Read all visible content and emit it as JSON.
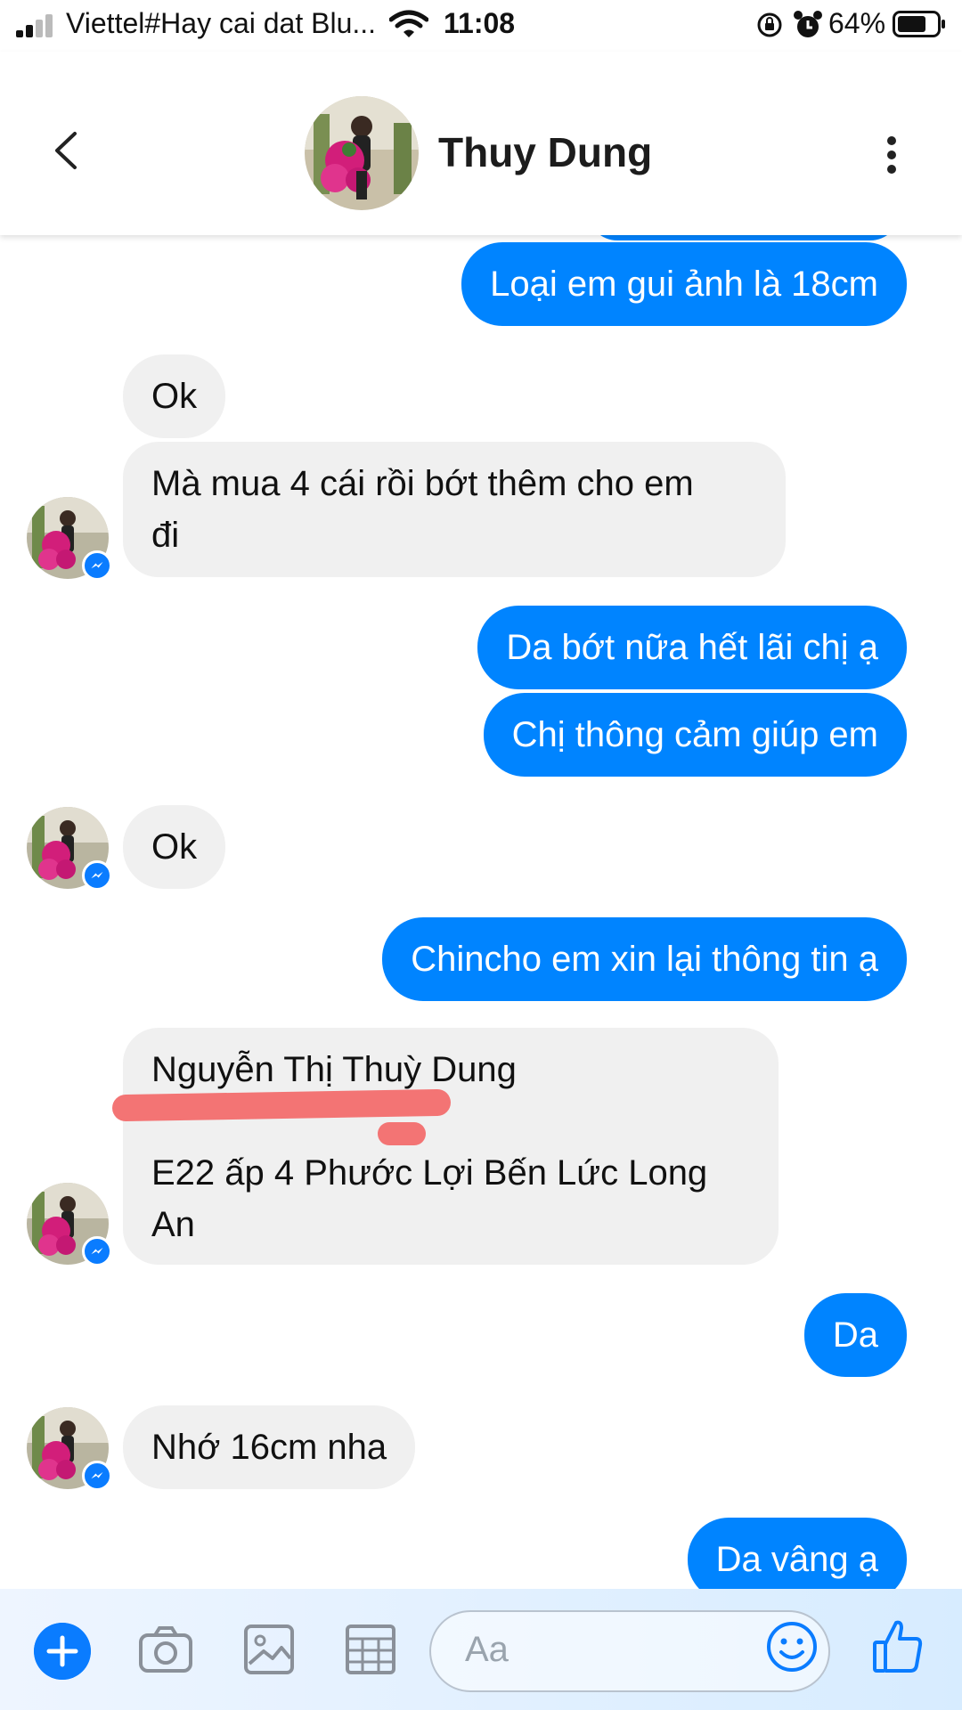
{
  "status_bar": {
    "carrier": "Viettel#Hay cai dat Blu...",
    "time": "11:08",
    "battery": "64%"
  },
  "header": {
    "contact_name": "Thuy Dung",
    "back_icon": "chevron-left-icon",
    "more_icon": "vertical-ellipsis-icon"
  },
  "messages": [
    {
      "side": "out",
      "lines": [
        "Loại em gui ảnh là 18cm"
      ]
    },
    {
      "side": "in",
      "lines": [
        "Ok"
      ]
    },
    {
      "side": "in",
      "lines": [
        "Mà mua 4 cái rồi bớt thêm cho em",
        "đi"
      ]
    },
    {
      "side": "out",
      "lines": [
        "Da bớt nữa hết lãi chị ạ"
      ]
    },
    {
      "side": "out",
      "lines": [
        "Chị thông cảm giúp em"
      ]
    },
    {
      "side": "in",
      "lines": [
        "Ok"
      ]
    },
    {
      "side": "out",
      "lines": [
        "Chincho em xin lại thông tin ạ"
      ]
    },
    {
      "side": "in",
      "lines": [
        "Nguyễn Thị Thuỳ Dung",
        "E22 ấp 4 Phước Lợi Bến Lức Long",
        "An"
      ]
    },
    {
      "side": "out",
      "lines": [
        "Da"
      ]
    },
    {
      "side": "in",
      "lines": [
        "Nhớ 16cm nha"
      ]
    },
    {
      "side": "out",
      "lines": [
        "Da vâng ạ"
      ]
    }
  ],
  "composer": {
    "placeholder": "Aa",
    "icons": [
      "plus-icon",
      "camera-icon",
      "image-icon",
      "grid-icon",
      "emoji-icon",
      "thumbs-up-icon"
    ]
  },
  "colors": {
    "outgoing_bubble": "#0084ff",
    "incoming_bubble": "#f0f0f0",
    "messenger_badge": "#0a7cff",
    "redaction": "#f26d6d"
  }
}
